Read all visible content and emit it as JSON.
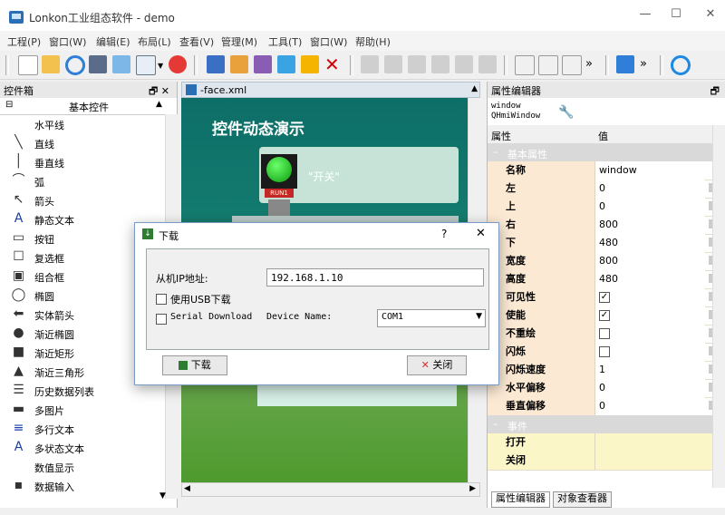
{
  "window": {
    "title": "Lonkon工业组态软件 - demo",
    "controls": [
      "—",
      "☐",
      "✕"
    ]
  },
  "menu": [
    "工程(P)",
    "窗口(W)",
    "编辑(E)",
    "布局(L)",
    "查看(V)",
    "管理(M)",
    "工具(T)",
    "窗口(W)",
    "帮助(H)"
  ],
  "toolbox": {
    "title": "控件箱",
    "pin": "🗗 ✕",
    "group": "基本控件",
    "items": [
      "水平线",
      "直线",
      "垂直线",
      "弧",
      "箭头",
      "静态文本",
      "按钮",
      "复选框",
      "组合框",
      "椭圆",
      "实体箭头",
      "渐近椭圆",
      "渐近矩形",
      "渐近三角形",
      "历史数据列表",
      "多图片",
      "多行文本",
      "多状态文本",
      "数值显示",
      "数据输入"
    ],
    "icons": [
      "hline-icon",
      "line-icon",
      "vline-icon",
      "arc-icon",
      "arrow-icon",
      "static-text-icon",
      "button-icon",
      "checkbox-icon",
      "combobox-icon",
      "ellipse-icon",
      "solid-arrow-icon",
      "gradient-ellipse-icon",
      "gradient-rect-icon",
      "gradient-triangle-icon",
      "history-list-icon",
      "multi-image-icon",
      "multiline-text-icon",
      "multistate-text-icon",
      "numeric-display-icon",
      "data-input-icon"
    ]
  },
  "document": {
    "tab": "-face.xml",
    "canvas_title": "控件动态演示",
    "switch_label": "\"开关\"",
    "run_label": "RUN1"
  },
  "properties": {
    "title": "属性编辑器",
    "object_name": "window",
    "object_class": "QHmiWindow",
    "col_prop": "属性",
    "col_value": "值",
    "section_basic": "基本属性",
    "section_events": "事件",
    "rows": [
      {
        "name": "名称",
        "value": "window",
        "type": "text"
      },
      {
        "name": "左",
        "value": "0",
        "type": "text"
      },
      {
        "name": "上",
        "value": "0",
        "type": "text"
      },
      {
        "name": "右",
        "value": "800",
        "type": "text"
      },
      {
        "name": "下",
        "value": "480",
        "type": "text"
      },
      {
        "name": "宽度",
        "value": "800",
        "type": "text"
      },
      {
        "name": "高度",
        "value": "480",
        "type": "text"
      },
      {
        "name": "可见性",
        "value": "✓",
        "type": "check"
      },
      {
        "name": "使能",
        "value": "✓",
        "type": "check"
      },
      {
        "name": "不重绘",
        "value": "",
        "type": "check"
      },
      {
        "name": "闪烁",
        "value": "",
        "type": "check"
      },
      {
        "name": "闪烁速度",
        "value": "1",
        "type": "text"
      },
      {
        "name": "水平偏移",
        "value": "0",
        "type": "text"
      },
      {
        "name": "垂直偏移",
        "value": "0",
        "type": "text"
      }
    ],
    "events": [
      "打开",
      "关闭"
    ],
    "tabs": [
      "属性编辑器",
      "对象查看器"
    ]
  },
  "dialog": {
    "title": "下载",
    "help": "?",
    "close": "✕",
    "ip_label": "从机IP地址:",
    "ip_value": "192.168.1.10",
    "usb_label": "使用USB下载",
    "serial_label": "Serial Download",
    "device_label": "Device Name:",
    "device_value": "COM1",
    "download_button": "下载",
    "close_button": "关闭"
  },
  "colors": {
    "accent": "#0078d7",
    "prop_name_bg": "#fbe9d4",
    "prop_section_bg": "#d9d9d9",
    "event_bg": "#fbf6c8"
  }
}
